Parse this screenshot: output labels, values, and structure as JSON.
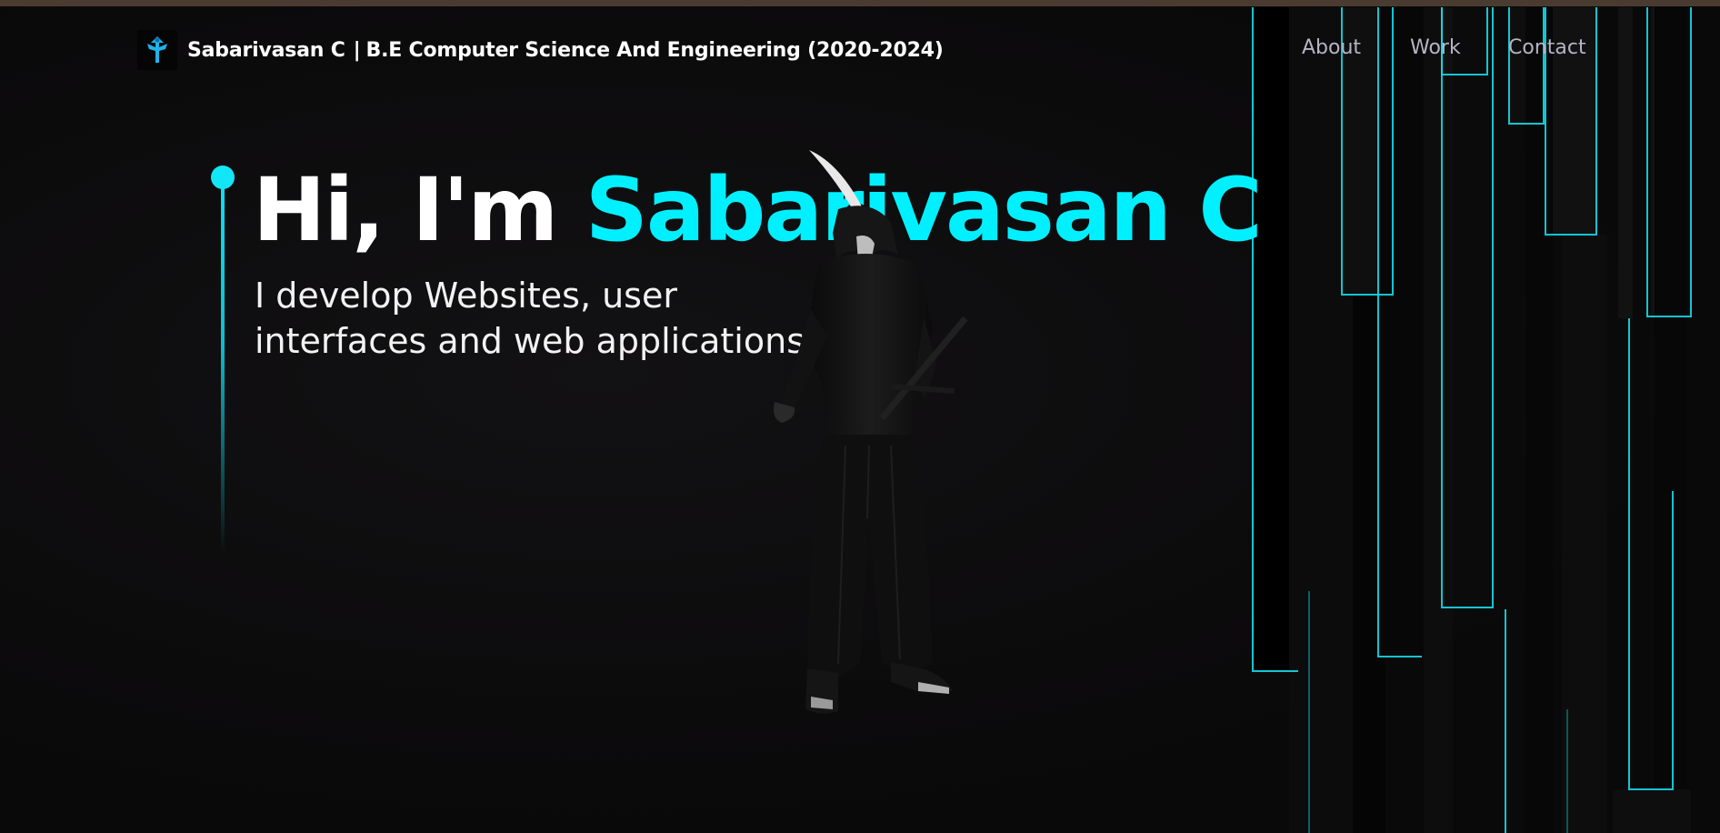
{
  "header": {
    "logo_icon": "hooded-figure-logo-icon",
    "brand_name": "Sabarivasan C",
    "separator": "|",
    "brand_subtitle": "B.E Computer Science And Engineering (2020-2024)"
  },
  "nav": {
    "items": [
      {
        "label": "About"
      },
      {
        "label": "Work"
      },
      {
        "label": "Contact"
      }
    ]
  },
  "hero": {
    "greeting": "Hi, I'm",
    "name": "Sabarivasan C",
    "tagline_line1": "I develop Websites, user",
    "tagline_line2": "interfaces and web applications"
  },
  "colors": {
    "accent": "#00f0ff",
    "background": "#0b0a0b",
    "nav_text": "#b6b4c4",
    "top_strip": "#4a3b31"
  },
  "decor": {
    "figure": "samurai-figure",
    "background": "neon-bars"
  }
}
